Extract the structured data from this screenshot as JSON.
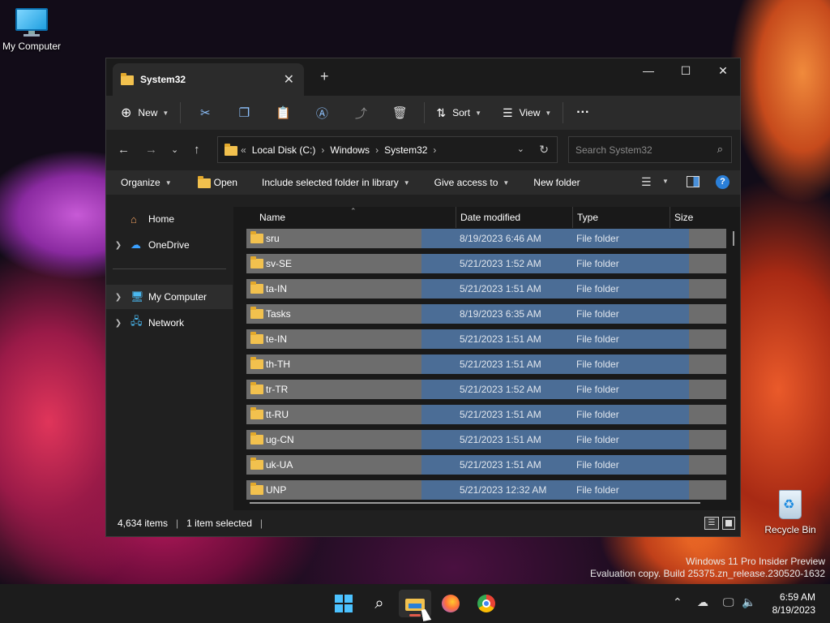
{
  "desktop": {
    "icons": [
      {
        "label": "My Computer"
      },
      {
        "label": "Recycle Bin"
      }
    ],
    "watermark_line1": "Windows 11 Pro Insider Preview",
    "watermark_line2": "Evaluation copy. Build 25375.zn_release.230520-1632"
  },
  "window": {
    "tab_title": "System32",
    "toolbar": {
      "new_label": "New",
      "sort_label": "Sort",
      "view_label": "View",
      "more_label": "···"
    },
    "address": {
      "prefix": "«",
      "crumbs": [
        "Local Disk (C:)",
        "Windows",
        "System32"
      ],
      "search_placeholder": "Search System32"
    },
    "command_bar": {
      "organize": "Organize",
      "open": "Open",
      "include": "Include selected folder in library",
      "give_access": "Give access to",
      "new_folder": "New folder"
    },
    "nav": {
      "home": "Home",
      "onedrive": "OneDrive",
      "my_computer": "My Computer",
      "network": "Network"
    },
    "columns": {
      "name": "Name",
      "date_modified": "Date modified",
      "type": "Type",
      "size": "Size"
    },
    "files": [
      {
        "name": "sru",
        "date": "8/19/2023 6:46 AM",
        "type": "File folder"
      },
      {
        "name": "sv-SE",
        "date": "5/21/2023 1:52 AM",
        "type": "File folder"
      },
      {
        "name": "ta-IN",
        "date": "5/21/2023 1:51 AM",
        "type": "File folder"
      },
      {
        "name": "Tasks",
        "date": "8/19/2023 6:35 AM",
        "type": "File folder"
      },
      {
        "name": "te-IN",
        "date": "5/21/2023 1:51 AM",
        "type": "File folder"
      },
      {
        "name": "th-TH",
        "date": "5/21/2023 1:51 AM",
        "type": "File folder"
      },
      {
        "name": "tr-TR",
        "date": "5/21/2023 1:52 AM",
        "type": "File folder"
      },
      {
        "name": "tt-RU",
        "date": "5/21/2023 1:51 AM",
        "type": "File folder"
      },
      {
        "name": "ug-CN",
        "date": "5/21/2023 1:51 AM",
        "type": "File folder"
      },
      {
        "name": "uk-UA",
        "date": "5/21/2023 1:51 AM",
        "type": "File folder"
      },
      {
        "name": "UNP",
        "date": "5/21/2023 12:32 AM",
        "type": "File folder"
      }
    ],
    "status": {
      "item_count": "4,634 items",
      "selected": "1 item selected"
    }
  },
  "taskbar": {
    "time": "6:59 AM",
    "date": "8/19/2023"
  },
  "colors": {
    "accent": "#8fc3ff",
    "selection": "#3d6ea8",
    "folder": "#f2c14e"
  }
}
